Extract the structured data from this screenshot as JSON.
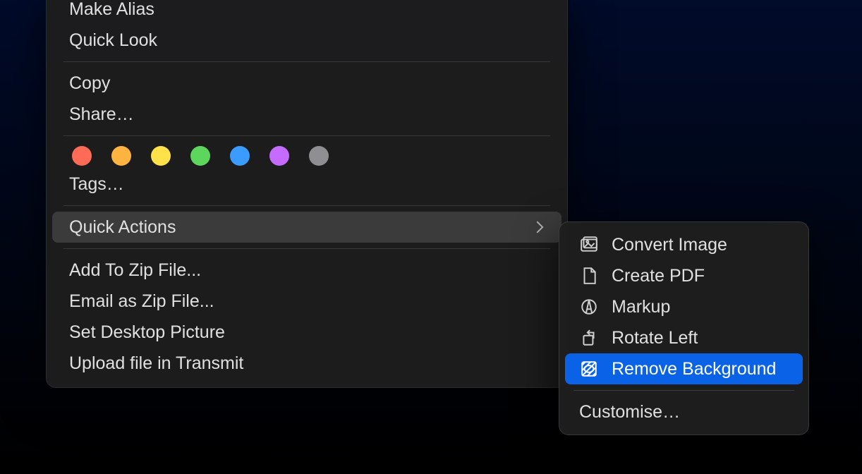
{
  "context_menu": {
    "items": [
      {
        "label": "Make Alias"
      },
      {
        "label": "Quick Look"
      },
      {
        "separator": true
      },
      {
        "label": "Copy"
      },
      {
        "label": "Share…"
      },
      {
        "separator": true
      },
      {
        "tags": true
      },
      {
        "label": "Tags…"
      },
      {
        "separator": true
      },
      {
        "label": "Quick Actions",
        "submenu": true,
        "highlighted": true
      },
      {
        "separator": true
      },
      {
        "label": "Add To Zip File..."
      },
      {
        "label": "Email as Zip File..."
      },
      {
        "label": "Set Desktop Picture"
      },
      {
        "label": "Upload file in Transmit"
      }
    ],
    "tag_colors": [
      "red",
      "orange",
      "yellow",
      "green",
      "blue",
      "purple",
      "gray"
    ]
  },
  "quick_actions_submenu": {
    "items": [
      {
        "label": "Convert Image",
        "icon": "image-icon"
      },
      {
        "label": "Create PDF",
        "icon": "document-icon"
      },
      {
        "label": "Markup",
        "icon": "markup-icon"
      },
      {
        "label": "Rotate Left",
        "icon": "rotate-left-icon"
      },
      {
        "label": "Remove Background",
        "icon": "remove-background-icon",
        "selected": true
      },
      {
        "separator": true
      },
      {
        "label": "Customise…"
      }
    ]
  }
}
